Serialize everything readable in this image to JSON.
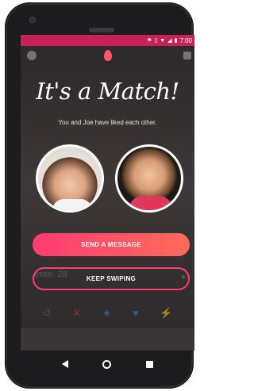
{
  "status_bar": {
    "time": "7:00",
    "icons": [
      "location-icon",
      "vibrate-icon",
      "wifi-icon",
      "signal-icon",
      "battery-icon"
    ],
    "color": "#c8215a"
  },
  "match_overlay": {
    "title": "It's a Match!",
    "subtitle": "You and Joe have liked each other.",
    "left_avatar": "woman-avatar",
    "right_avatar": "man-avatar",
    "send_message_label": "SEND A MESSAGE",
    "keep_swiping_label": "KEEP SWIPING",
    "background_card_text": "esse, 28",
    "accent": "#fe3c72"
  },
  "bottom_actions": [
    {
      "icon": "rewind-icon",
      "glyph": "↺",
      "color": "#6b6262"
    },
    {
      "icon": "nope-icon",
      "glyph": "✕",
      "color": "#d6354a"
    },
    {
      "icon": "superlike-icon",
      "glyph": "★",
      "color": "#3a7bd5"
    },
    {
      "icon": "like-icon",
      "glyph": "♥",
      "color": "#3a7bd5"
    },
    {
      "icon": "boost-icon",
      "glyph": "⚡",
      "color": "#6b5aa8"
    }
  ]
}
